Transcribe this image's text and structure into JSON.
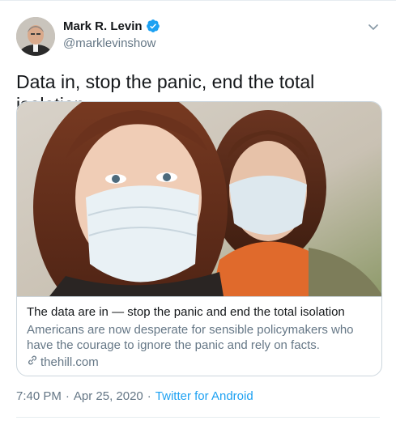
{
  "author": {
    "display_name": "Mark R. Levin",
    "handle": "@marklevinshow",
    "verified": true
  },
  "tweet": {
    "text": "Data in, stop the panic, end the total isolation"
  },
  "card": {
    "title": "The data are in — stop the panic and end the total isolation",
    "description": "Americans are now desperate for sensible policymakers who have the courage to ignore the panic and rely on facts.",
    "domain": "thehill.com"
  },
  "meta": {
    "time": "7:40 PM",
    "separator": "·",
    "date": "Apr 25, 2020",
    "source": "Twitter for Android"
  },
  "colors": {
    "verified_blue": "#1da1f2",
    "link_blue": "#1da1f2",
    "secondary_text": "#657786"
  },
  "icons": {
    "verified": "verified-badge-icon",
    "chevron": "chevron-down-icon",
    "link": "link-icon"
  }
}
